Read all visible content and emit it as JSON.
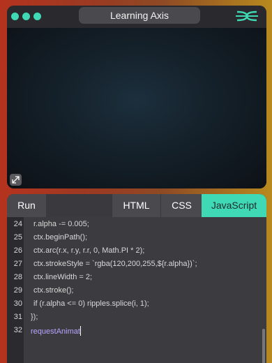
{
  "app": {
    "title": "Learning Axis",
    "accent_color": "#3fd9b6",
    "logo_icon": "logo-icon",
    "expand_icon": "expand-icon"
  },
  "editor": {
    "run_label": "Run",
    "tabs": [
      {
        "label": "HTML",
        "active": false
      },
      {
        "label": "CSS",
        "active": false
      },
      {
        "label": "JavaScript",
        "active": true
      }
    ],
    "lines": [
      {
        "num": "24",
        "code": "r.alpha -= 0.005;"
      },
      {
        "num": "25",
        "code": "ctx.beginPath();"
      },
      {
        "num": "26",
        "code": "ctx.arc(r.x, r.y, r.r, 0, Math.PI * 2);"
      },
      {
        "num": "27",
        "code": "ctx.strokeStyle = `rgba(120,200,255,${r.alpha})`;"
      },
      {
        "num": "28",
        "code": "ctx.lineWidth = 2;"
      },
      {
        "num": "29",
        "code": "ctx.stroke();"
      },
      {
        "num": "30",
        "code": "if (r.alpha <= 0) ripples.splice(i, 1);"
      },
      {
        "num": "31",
        "code": "});"
      },
      {
        "num": "32",
        "code": "requestAnimat"
      }
    ]
  }
}
